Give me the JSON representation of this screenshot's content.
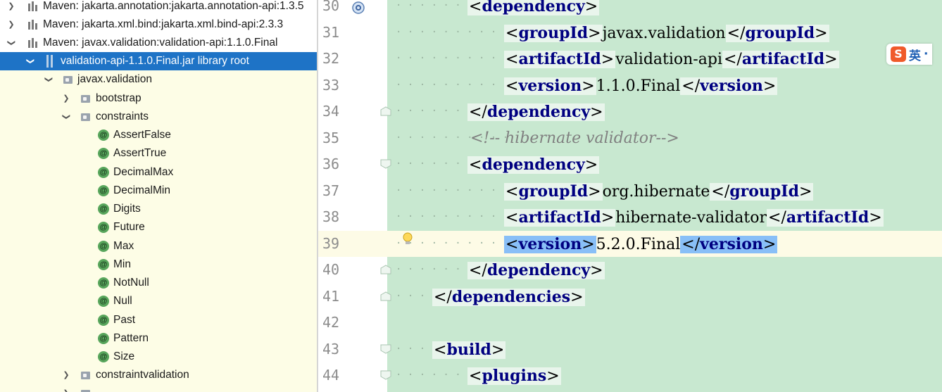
{
  "tree": {
    "rows": [
      {
        "label": "Maven: jakarta.annotation:jakarta.annotation-api:1.3.5",
        "icon": "library-icon",
        "arrow": "›"
      },
      {
        "label": "Maven: jakarta.xml.bind:jakarta.xml.bind-api:2.3.3",
        "icon": "library-icon",
        "arrow": "›"
      },
      {
        "label": "Maven: javax.validation:validation-api:1.1.0.Final",
        "icon": "library-icon",
        "arrow": "⌄"
      },
      {
        "label": "validation-api-1.1.0.Final.jar library root",
        "icon": "jar-icon",
        "arrow": "⌄"
      },
      {
        "label": "javax.validation",
        "icon": "package-icon",
        "arrow": "⌄"
      },
      {
        "label": "bootstrap",
        "icon": "package-icon",
        "arrow": "›"
      },
      {
        "label": "constraints",
        "icon": "package-icon",
        "arrow": "⌄"
      },
      {
        "label": "AssertFalse",
        "icon": "annotation-icon"
      },
      {
        "label": "AssertTrue",
        "icon": "annotation-icon"
      },
      {
        "label": "DecimalMax",
        "icon": "annotation-icon"
      },
      {
        "label": "DecimalMin",
        "icon": "annotation-icon"
      },
      {
        "label": "Digits",
        "icon": "annotation-icon"
      },
      {
        "label": "Future",
        "icon": "annotation-icon"
      },
      {
        "label": "Max",
        "icon": "annotation-icon"
      },
      {
        "label": "Min",
        "icon": "annotation-icon"
      },
      {
        "label": "NotNull",
        "icon": "annotation-icon"
      },
      {
        "label": "Null",
        "icon": "annotation-icon"
      },
      {
        "label": "Past",
        "icon": "annotation-icon"
      },
      {
        "label": "Pattern",
        "icon": "annotation-icon"
      },
      {
        "label": "Size",
        "icon": "annotation-icon"
      },
      {
        "label": "constraintvalidation",
        "icon": "package-icon",
        "arrow": "›"
      }
    ],
    "annotation_glyph": "@"
  },
  "editor": {
    "lines": [
      {
        "num": "30",
        "open": "dependency",
        "close": null
      },
      {
        "num": "31",
        "open": "groupId",
        "text": "javax.validation",
        "close": "groupId"
      },
      {
        "num": "32",
        "open": "artifactId",
        "text": "validation-api",
        "close": "artifactId"
      },
      {
        "num": "33",
        "open": "version",
        "text": "1.1.0.Final",
        "close": "version"
      },
      {
        "num": "34",
        "close_only": "dependency"
      },
      {
        "num": "35",
        "comment": "<!-- hibernate validator-->"
      },
      {
        "num": "36",
        "open": "dependency"
      },
      {
        "num": "37",
        "open": "groupId",
        "text": "org.hibernate",
        "close": "groupId"
      },
      {
        "num": "38",
        "open": "artifactId",
        "text": "hibernate-validator",
        "close": "artifactId"
      },
      {
        "num": "39",
        "open": "version",
        "text": "5.2.0.Final",
        "close": "version"
      },
      {
        "num": "40",
        "close_only": "dependency"
      },
      {
        "num": "41",
        "close_only": "dependencies"
      },
      {
        "num": "42"
      },
      {
        "num": "43",
        "open": "build"
      },
      {
        "num": "44",
        "open": "plugins"
      }
    ]
  },
  "ime": {
    "logo": "S",
    "mode": "英",
    "dot": "·"
  },
  "colors": {
    "selection": "#1e73c6",
    "code_bg": "#c8e8d0",
    "tag": "#000080",
    "current_line": "#fdfbe6",
    "tag_highlight": "#89bff7"
  }
}
